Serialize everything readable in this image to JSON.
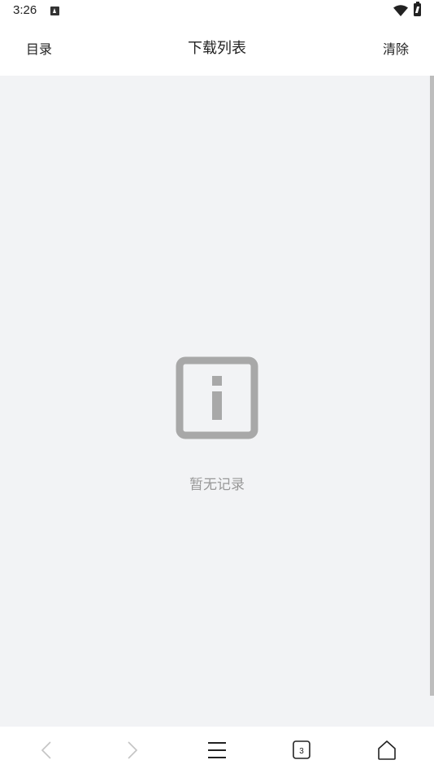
{
  "status_bar": {
    "time": "3:26",
    "icons": [
      "notification-a-icon",
      "wifi-icon",
      "battery-charging-icon"
    ]
  },
  "header": {
    "left_label": "目录",
    "title": "下载列表",
    "right_label": "清除"
  },
  "empty_state": {
    "icon": "info-icon",
    "message": "暂无记录"
  },
  "bottom_nav": {
    "items": [
      {
        "icon": "back-arrow-icon",
        "enabled": false
      },
      {
        "icon": "forward-arrow-icon",
        "enabled": false
      },
      {
        "icon": "menu-icon",
        "enabled": true
      },
      {
        "icon": "tabs-icon",
        "enabled": true,
        "count": "3"
      },
      {
        "icon": "home-icon",
        "enabled": true
      }
    ]
  },
  "colors": {
    "content_bg": "#f2f3f5",
    "icon_gray": "#a8a8a8",
    "text_muted": "#999999",
    "text_dark": "#222222",
    "disabled_icon": "#c4c4c4"
  }
}
